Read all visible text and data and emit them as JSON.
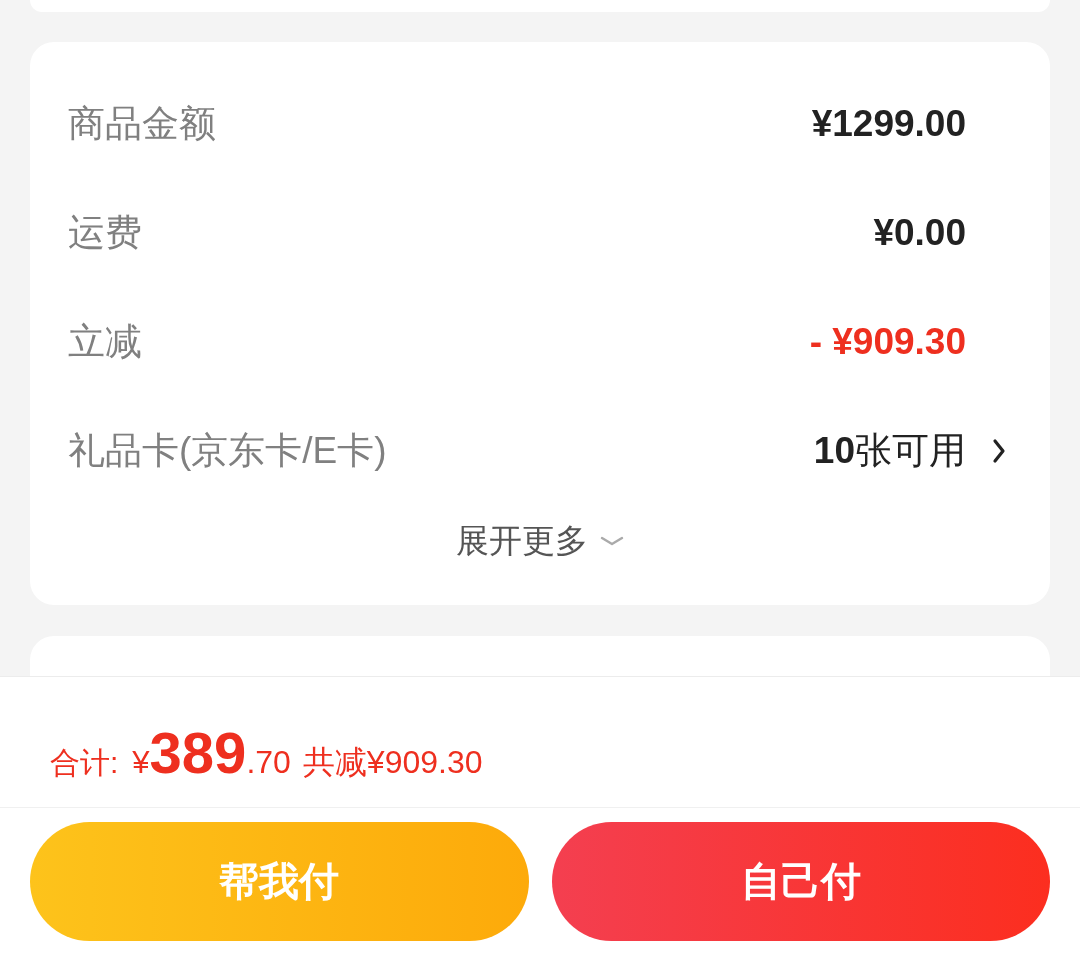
{
  "summary": {
    "rows": [
      {
        "kind": "amount",
        "label": "商品金额",
        "value": "¥1299.00"
      },
      {
        "kind": "amount",
        "label": "运费",
        "value": "¥0.00"
      },
      {
        "kind": "discount",
        "label": "立减",
        "value": "- ¥909.30"
      },
      {
        "kind": "link",
        "label": "礼品卡(京东卡/E卡)",
        "value": "**10**张可用"
      }
    ],
    "expand": {
      "label": "展开更多"
    }
  },
  "total": {
    "label": "合计:",
    "currency": "¥",
    "integer": "389",
    "decimal": ".70",
    "saving": "共减¥909.30"
  },
  "buttons": [
    {
      "kind": "secondary",
      "label": "帮我付"
    },
    {
      "kind": "primary",
      "label": "自己付"
    }
  ]
}
